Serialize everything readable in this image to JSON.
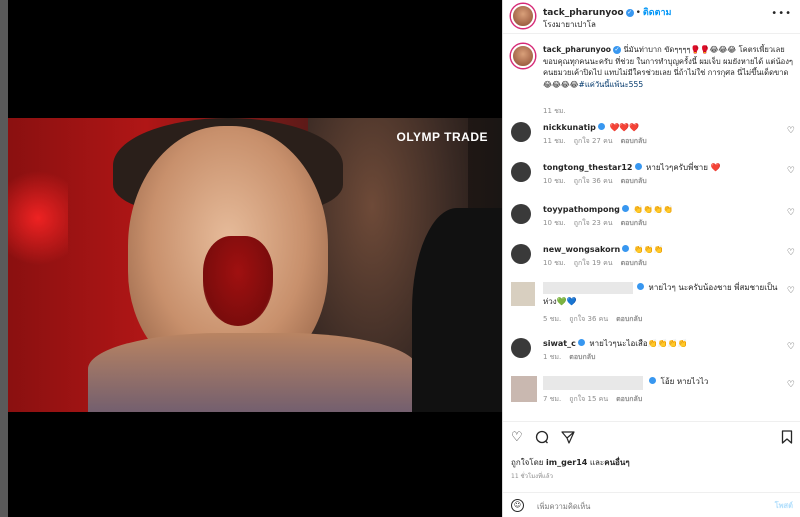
{
  "media": {
    "watermark": "OLYMP TRADE"
  },
  "header": {
    "username": "tack_pharunyoo",
    "follow_label": "ติดตาม",
    "location": "โรงมายาเปาโล",
    "more_label": "•••"
  },
  "caption": {
    "username": "tack_pharunyoo",
    "text": "นี่มันท่าบาก ขัดๆๆๆๆ🥊🥊😂😂😂 โคตรเพี้ยวเลย ขอบคุณทุกคนนะครับ ที่ช่วย ในการทำบุญครั้งนี้ ผมเจ็บ ผมยังหายได้ แต่น้องๆคนยมวยเค้าปิดไป แทบไม่มีใครช่วยเลย นี่ถ้าไม่ใช่ การกุศล นี่ไม่ขึ้นเด็ดขาด😂😂😂😂",
    "hashtag": "#แค่วันนี้แพ้นะ555",
    "time": "11 ชม."
  },
  "comments": [
    {
      "username": "nickkunatip",
      "text": "❤️❤️❤️",
      "time": "11 ชม.",
      "likes": "ถูกใจ 27 คน",
      "reply": "ตอบกลับ"
    },
    {
      "username": "tongtong_thestar12",
      "text": "หายไวๆครับพี่ชาย ❤️",
      "time": "10 ชม.",
      "likes": "ถูกใจ 36 คน",
      "reply": "ตอบกลับ"
    },
    {
      "username": "toyypathompong",
      "text": "👏👏👏👏",
      "time": "10 ชม.",
      "likes": "ถูกใจ 23 คน",
      "reply": "ตอบกลับ"
    },
    {
      "username": "new_wongsakorn",
      "text": "👏👏👏",
      "time": "10 ชม.",
      "likes": "ถูกใจ 19 คน",
      "reply": "ตอบกลับ"
    },
    {
      "username": "",
      "text": "หายไวๆ นะครับน้องชาย พี่สมชายเป็น",
      "text2": "ห่วง💚💙",
      "time": "5 ชม.",
      "likes": "ถูกใจ 36 คน",
      "reply": "ตอบกลับ"
    },
    {
      "username": "siwat_c",
      "text": "หายไวๆนะไอเสือ👏👏👏👏",
      "time": "1 ชม.",
      "likes": "",
      "reply": "ตอบกลับ"
    },
    {
      "username": "",
      "text": "โอ้ย หายไวไว",
      "time": "7 ชม.",
      "likes": "ถูกใจ 15 คน",
      "reply": "ตอบกลับ"
    }
  ],
  "actions": {
    "liked_by_prefix": "ถูกใจโดย",
    "liked_by_user": "im_ger14",
    "liked_by_suffix": "และ",
    "liked_by_others": "คนอื่นๆ",
    "post_time": "11 ชั่วโมงที่แล้ว",
    "comment_placeholder": "เพิ่มความคิดเห็น",
    "post_label": "โพสต์"
  },
  "colors": {
    "accent": "#0095f6",
    "verified": "#3897f0"
  }
}
